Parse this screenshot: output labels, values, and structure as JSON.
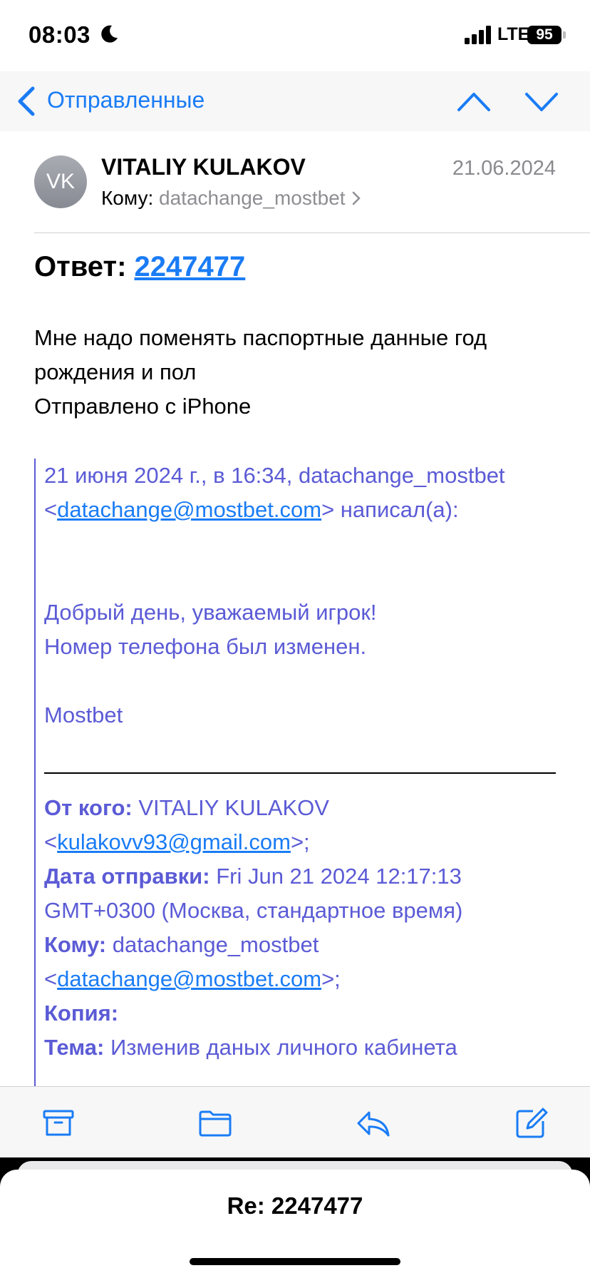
{
  "status_bar": {
    "time": "08:03",
    "network": "LTE",
    "battery": "95"
  },
  "nav": {
    "back_label": "Отправленные"
  },
  "header": {
    "avatar_initials": "VK",
    "sender": "VITALIY KULAKOV",
    "date": "21.06.2024",
    "to_label": "Кому:",
    "to_value": "datachange_mostbet"
  },
  "subject": {
    "prefix": "Ответ:",
    "number": "2247477"
  },
  "body": {
    "lines": [
      "Мне надо поменять паспортные данные год",
      "рождения и пол",
      "Отправлено с iPhone"
    ]
  },
  "quote": {
    "intro_line1": "21 июня 2024 г., в 16:34, datachange_mostbet",
    "intro_lt": "<",
    "intro_email": "datachange@mostbet.com",
    "intro_tail": "> написал(а):",
    "greeting": "Добрый день, уважаемый игрок!",
    "message": "Номер телефона был изменен.",
    "signature": "Mostbet",
    "from_label": "От кого:",
    "from_name": "VITALIY KULAKOV",
    "from_lt": "<",
    "from_email": "kulakovv93@gmail.com",
    "from_tail": ">;",
    "date_label": "Дата отправки:",
    "date_value_1": "Fri Jun 21 2024 12:17:13",
    "date_value_2": "GMT+0300 (Москва, стандартное время)",
    "to_label": "Кому:",
    "to_name": "datachange_mostbet",
    "to_lt": "<",
    "to_email": "datachange@mostbet.com",
    "to_tail": ">;",
    "cc_label": "Копия:",
    "subject_label": "Тема:",
    "subject_value": "Изменив даных личного кабинета"
  },
  "bottom_card": {
    "title": "Re: 2247477"
  },
  "colors": {
    "accent": "#1a7cf5",
    "quote": "#5b5bd6",
    "muted": "#8e8e93"
  },
  "toolbar": {
    "icons": [
      "archive-icon",
      "folder-icon",
      "reply-icon",
      "compose-icon"
    ]
  }
}
